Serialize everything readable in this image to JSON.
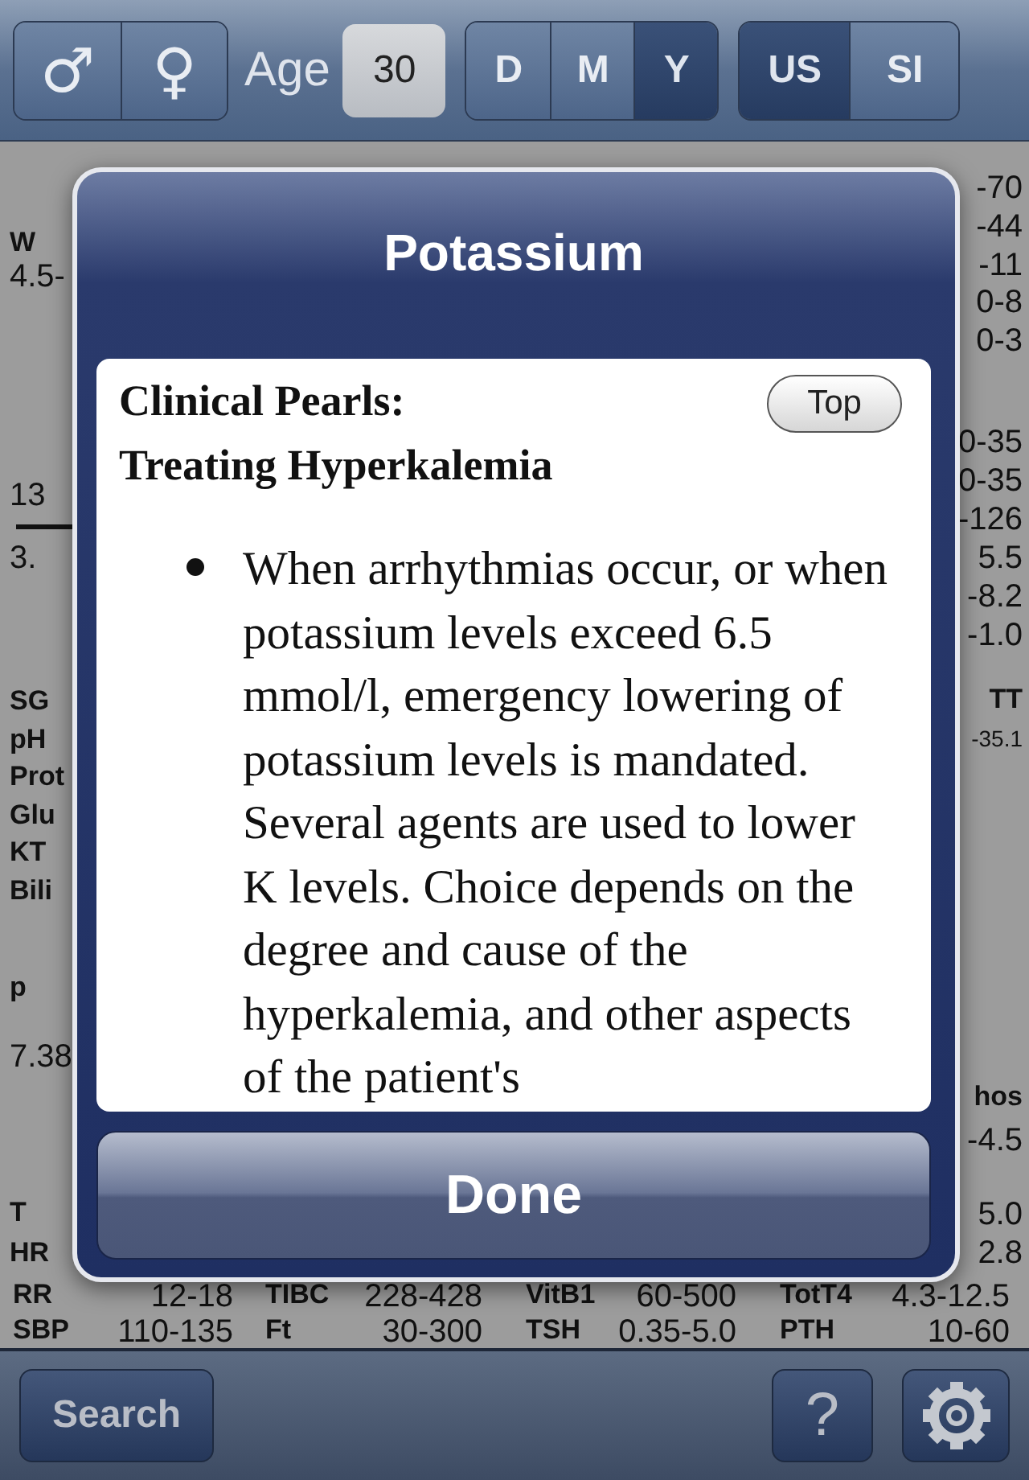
{
  "toolbar": {
    "gender": [
      {
        "symbol": "♂",
        "selected": false
      },
      {
        "symbol": "♀",
        "selected": false
      }
    ],
    "age_label": "Age",
    "age_value": "30",
    "units": [
      {
        "label": "D",
        "selected": false
      },
      {
        "label": "M",
        "selected": false
      },
      {
        "label": "Y",
        "selected": true
      }
    ],
    "systems": [
      {
        "label": "US",
        "selected": true
      },
      {
        "label": "SI",
        "selected": false
      }
    ]
  },
  "background": {
    "left_edge": [
      {
        "text": "W",
        "kind": "label"
      },
      {
        "text": "4.5-",
        "kind": "value"
      },
      {
        "text": "13",
        "kind": "value"
      },
      {
        "text": "3.",
        "kind": "value"
      },
      {
        "text": "SG",
        "kind": "label"
      },
      {
        "text": "pH",
        "kind": "label"
      },
      {
        "text": "Prot",
        "kind": "label"
      },
      {
        "text": "Glu",
        "kind": "label"
      },
      {
        "text": "KT",
        "kind": "label"
      },
      {
        "text": "Bili",
        "kind": "label"
      },
      {
        "text": "p",
        "kind": "label"
      },
      {
        "text": "7.38",
        "kind": "value"
      },
      {
        "text": "T",
        "kind": "label"
      },
      {
        "text": "HR",
        "kind": "label"
      }
    ],
    "right_edge": [
      {
        "text": "-70",
        "kind": "value"
      },
      {
        "text": "-44",
        "kind": "value"
      },
      {
        "text": "-11",
        "kind": "value"
      },
      {
        "text": "0-8",
        "kind": "value"
      },
      {
        "text": "0-3",
        "kind": "value"
      },
      {
        "text": "0-35",
        "kind": "value"
      },
      {
        "text": "0-35",
        "kind": "value"
      },
      {
        "text": "-126",
        "kind": "value"
      },
      {
        "text": "5.5",
        "kind": "value"
      },
      {
        "text": "-8.2",
        "kind": "value"
      },
      {
        "text": "-1.0",
        "kind": "value"
      },
      {
        "text": "TT",
        "kind": "label"
      },
      {
        "text": "-35.1",
        "kind": "small"
      },
      {
        "text": "hos",
        "kind": "label"
      },
      {
        "text": "-4.5",
        "kind": "value"
      },
      {
        "text": "5.0",
        "kind": "value"
      },
      {
        "text": "2.8",
        "kind": "value"
      }
    ],
    "rows": [
      [
        "RR",
        "12-18",
        "TIBC",
        "228-428",
        "VitB1",
        "60-500",
        "TotT4",
        "4.3-12.5"
      ],
      [
        "SBP",
        "110-135",
        "Ft",
        "30-300",
        "TSH",
        "0.35-5.0",
        "PTH",
        "10-60"
      ]
    ]
  },
  "dialog": {
    "title": "Potassium",
    "heading_lines": [
      "Clinical Pearls:",
      "Treating Hyperkalemia"
    ],
    "top_button": "Top",
    "bullets": [
      "When arrhythmias occur, or when potassium levels exceed 6.5 mmol/l, emergency lowering of potassium levels is mandated. Several agents are used to lower K levels. Choice depends on the degree and cause of the hyperkalemia, and other aspects of the patient's"
    ],
    "done_button": "Done"
  },
  "bottom_bar": {
    "search_button": "Search",
    "help_button": "?"
  }
}
